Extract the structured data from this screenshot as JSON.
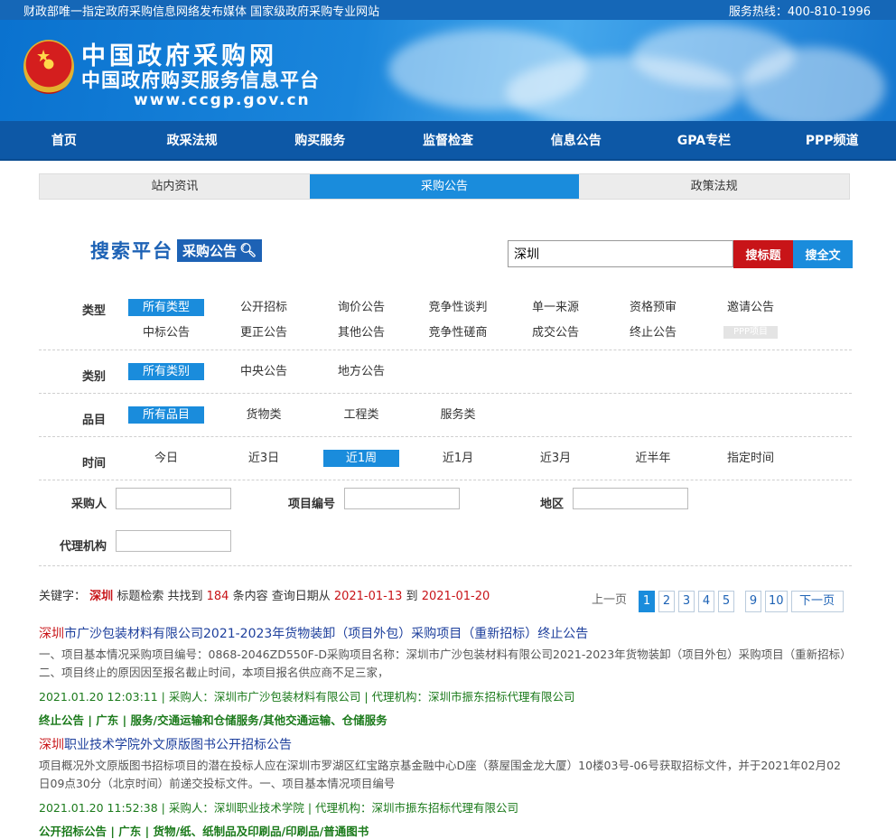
{
  "topbar": {
    "left": "财政部唯一指定政府采购信息网络发布媒体 国家级政府采购专业网站",
    "hotline": "服务热线：400-810-1996"
  },
  "banner": {
    "title": "中国政府采购网",
    "subtitle": "中国政府购买服务信息平台",
    "url": "www.ccgp.gov.cn"
  },
  "nav": [
    "首页",
    "政采法规",
    "购买服务",
    "监督检查",
    "信息公告",
    "GPA专栏",
    "PPP频道"
  ],
  "tabs": [
    "站内资讯",
    "采购公告",
    "政策法规"
  ],
  "search": {
    "logo_main": "搜索平台",
    "logo_box": "采购公告",
    "value": "深圳",
    "btn_title": "搜标题",
    "btn_full": "搜全文"
  },
  "filters": {
    "type_label": "类型",
    "types": [
      "所有类型",
      "公开招标",
      "询价公告",
      "竞争性谈判",
      "单一来源",
      "资格预审",
      "邀请公告",
      "中标公告",
      "更正公告",
      "其他公告",
      "竞争性磋商",
      "成交公告",
      "终止公告",
      "PPP项目"
    ],
    "category_label": "类别",
    "categories": [
      "所有类别",
      "中央公告",
      "地方公告"
    ],
    "item_label": "品目",
    "items": [
      "所有品目",
      "货物类",
      "工程类",
      "服务类"
    ],
    "time_label": "时间",
    "times": [
      "今日",
      "近3日",
      "近1周",
      "近1月",
      "近3月",
      "近半年",
      "指定时间"
    ]
  },
  "fields": {
    "buyer": "采购人",
    "project_no": "项目编号",
    "region": "地区",
    "agency": "代理机构"
  },
  "summary": {
    "prefix": "关键字：",
    "keyword": "深圳",
    "t1": "标题检索 共找到",
    "count": "184",
    "t2": "条内容 查询日期从",
    "from": "2021-01-13",
    "to_word": "到",
    "to": "2021-01-20"
  },
  "pager": {
    "prev": "上一页",
    "pages": [
      "1",
      "2",
      "3",
      "4",
      "5",
      "9",
      "10"
    ],
    "next": "下一页"
  },
  "results": [
    {
      "hl": "深圳",
      "title": "市广沙包装材料有限公司2021-2023年货物装卸（项目外包）采购项目（重新招标）终止公告",
      "summary": "一、项目基本情况采购项目编号：0868-2046ZD550F-D采购项目名称：深圳市广沙包装材料有限公司2021-2023年货物装卸（项目外包）采购项目（重新招标）二、项目终止的原因因至报名截止时间，本项目报名供应商不足三家，",
      "meta": "2021.01.20 12:03:11 | 采购人：深圳市广沙包装材料有限公司 | 代理机构：深圳市振东招标代理有限公司",
      "category": "终止公告 | 广东 | 服务/交通运输和仓储服务/其他交通运输、仓储服务"
    },
    {
      "hl": "深圳",
      "title": "职业技术学院外文原版图书公开招标公告",
      "summary": "项目概况外文原版图书招标项目的潜在投标人应在深圳市罗湖区红宝路京基金融中心D座（蔡屋围金龙大厦）10楼03号-06号获取招标文件，并于2021年02月02日09点30分（北京时间）前递交投标文件。一、项目基本情况项目编号",
      "meta": "2021.01.20 11:52:38 | 采购人：深圳职业技术学院 | 代理机构：深圳市振东招标代理有限公司",
      "category": "公开招标公告 | 广东 | 货物/纸、纸制品及印刷品/印刷品/普通图书"
    }
  ]
}
